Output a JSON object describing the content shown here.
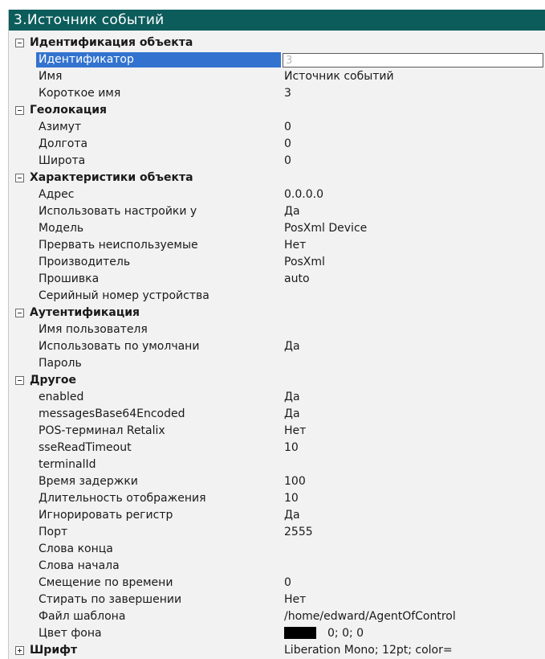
{
  "window": {
    "title": "3.Источник событий"
  },
  "groups": [
    {
      "label": "Идентификация объекта",
      "expanded": true,
      "props": [
        {
          "name": "Идентификатор",
          "value": "3",
          "selected": true,
          "editor": true
        },
        {
          "name": "Имя",
          "value": "Источник событий"
        },
        {
          "name": "Короткое имя",
          "value": "3"
        }
      ]
    },
    {
      "label": "Геолокация",
      "expanded": true,
      "props": [
        {
          "name": "Азимут",
          "value": "0"
        },
        {
          "name": "Долгота",
          "value": "0"
        },
        {
          "name": "Широта",
          "value": "0"
        }
      ]
    },
    {
      "label": "Характеристики объекта",
      "expanded": true,
      "props": [
        {
          "name": "Адрес",
          "value": "0.0.0.0"
        },
        {
          "name": "Использовать настройки у",
          "value": "Да"
        },
        {
          "name": "Модель",
          "value": "PosXml Device"
        },
        {
          "name": "Прервать неиспользуемые",
          "value": "Нет"
        },
        {
          "name": "Производитель",
          "value": "PosXml"
        },
        {
          "name": "Прошивка",
          "value": "auto"
        },
        {
          "name": "Серийный номер устройства",
          "value": ""
        }
      ]
    },
    {
      "label": "Аутентификация",
      "expanded": true,
      "props": [
        {
          "name": "Имя пользователя",
          "value": ""
        },
        {
          "name": "Использовать по умолчани",
          "value": "Да"
        },
        {
          "name": "Пароль",
          "value": ""
        }
      ]
    },
    {
      "label": "Другое",
      "expanded": true,
      "props": [
        {
          "name": "enabled",
          "value": "Да"
        },
        {
          "name": "messagesBase64Encoded",
          "value": "Да"
        },
        {
          "name": "POS-терминал Retalix",
          "value": "Нет"
        },
        {
          "name": "sseReadTimeout",
          "value": "10"
        },
        {
          "name": "terminalId",
          "value": ""
        },
        {
          "name": "Время задержки",
          "value": "100"
        },
        {
          "name": "Длительность отображения",
          "value": "10"
        },
        {
          "name": "Игнорировать регистр",
          "value": "Да"
        },
        {
          "name": "Порт",
          "value": "2555"
        },
        {
          "name": "Слова конца",
          "value": ""
        },
        {
          "name": "Слова начала",
          "value": ""
        },
        {
          "name": "Смещение по времени",
          "value": "0"
        },
        {
          "name": "Стирать по завершении",
          "value": "Нет"
        },
        {
          "name": "Файл шаблона",
          "value": "/home/edward/AgentOfControl"
        },
        {
          "name": "Цвет фона",
          "value": "0; 0; 0",
          "swatch": "#000000"
        }
      ]
    },
    {
      "label": "Шрифт",
      "expanded": false,
      "value": "Liberation Mono; 12pt; color=",
      "props": []
    }
  ],
  "colors": {
    "title_bg": "#0d5c5c",
    "selection": "#3373cf"
  }
}
